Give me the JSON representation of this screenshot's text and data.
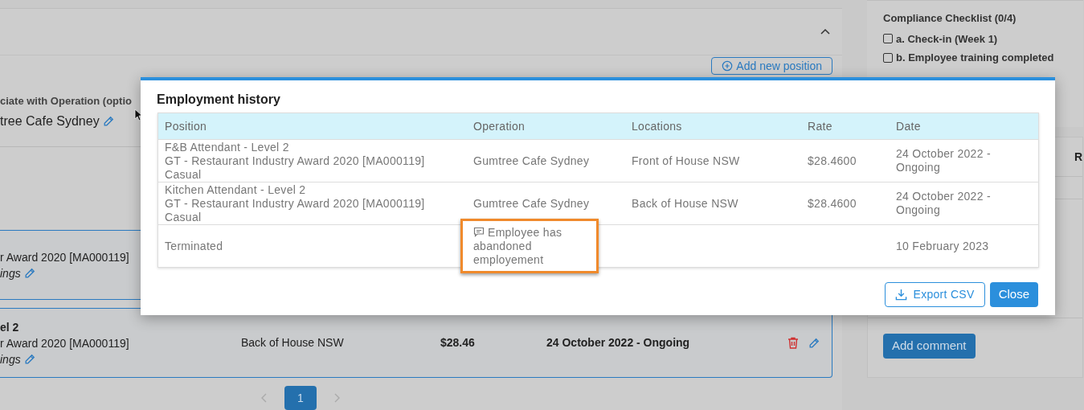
{
  "background": {
    "add_position_button": "Add new position",
    "operation_label": "ciate with Operation (optio",
    "operation_value": "tree Cafe Sydney",
    "positions": [
      {
        "award": "r Award 2020 [MA000119]",
        "settings": "ings"
      },
      {
        "title": "el 2",
        "award": "r Award 2020 [MA000119]",
        "settings": "ings",
        "location": "Back of House NSW",
        "rate": "$28.46",
        "date": "24 October 2022 - Ongoing"
      }
    ],
    "pages": [
      {
        "label": "1",
        "selected": true
      }
    ],
    "checklist": {
      "title": "Compliance Checklist (0/4)",
      "items": [
        {
          "label": "a. Check-in (Week 1)",
          "checked": false
        },
        {
          "label": "b. Employee training completed",
          "checked": false
        }
      ]
    },
    "column_heading": "R",
    "add_comment_button": "Add comment"
  },
  "modal": {
    "title": "Employment history",
    "columns": [
      "Position",
      "Operation",
      "Locations",
      "Rate",
      "Date"
    ],
    "rows": [
      {
        "position": [
          "F&B Attendant - Level 2",
          "GT - Restaurant Industry Award 2020 [MA000119]",
          "Casual"
        ],
        "operation": {
          "text": "Gumtree Cafe Sydney",
          "comment": false,
          "highlighted": false
        },
        "location": "Front of House NSW",
        "rate": "$28.4600",
        "date": "24 October 2022 - Ongoing"
      },
      {
        "position": [
          "Kitchen Attendant - Level 2",
          "GT - Restaurant Industry Award 2020 [MA000119]",
          "Casual"
        ],
        "operation": {
          "text": "Gumtree Cafe Sydney",
          "comment": false,
          "highlighted": false
        },
        "location": "Back of House NSW",
        "rate": "$28.4600",
        "date": "24 October 2022 - Ongoing"
      },
      {
        "position": [
          "Terminated"
        ],
        "operation": {
          "text": "Employee has abandoned employement",
          "comment": true,
          "highlighted": true
        },
        "date": "10 February 2023"
      }
    ],
    "export_button": "Export CSV",
    "close_button": "Close"
  }
}
